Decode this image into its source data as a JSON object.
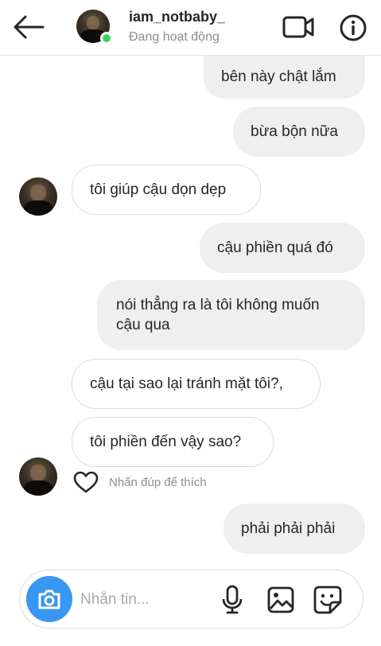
{
  "header": {
    "username": "iam_notbaby_",
    "status": "Đang hoạt động",
    "back_icon": "arrow-left-icon",
    "video_icon": "video-camera-icon",
    "info_icon": "info-icon",
    "online_color": "#3bd25a"
  },
  "messages": [
    {
      "from": "me",
      "text": "bên này chật lắm"
    },
    {
      "from": "me",
      "text": "bừa bộn nữa"
    },
    {
      "from": "them",
      "text": "tôi giúp cậu dọn dẹp"
    },
    {
      "from": "me",
      "text": "cậu phiền quá đó"
    },
    {
      "from": "me",
      "text": "nói thẳng ra là tôi không muốn cậu qua"
    },
    {
      "from": "them",
      "text": "cậu tại sao lại tránh mặt tôi?,"
    },
    {
      "from": "them",
      "text": "tôi phiền đến vậy sao?"
    },
    {
      "from": "me",
      "text": "phải phải phải"
    }
  ],
  "like_hint": "Nhấn đúp để thích",
  "composer": {
    "placeholder": "Nhắn tin...",
    "camera_icon": "camera-icon",
    "mic_icon": "microphone-icon",
    "gallery_icon": "image-icon",
    "sticker_icon": "sticker-icon",
    "accent": "#3897f0"
  },
  "colors": {
    "outgoing_bubble": "#efefef",
    "incoming_border": "#dbdbdb",
    "muted_text": "#8e8e8e"
  }
}
